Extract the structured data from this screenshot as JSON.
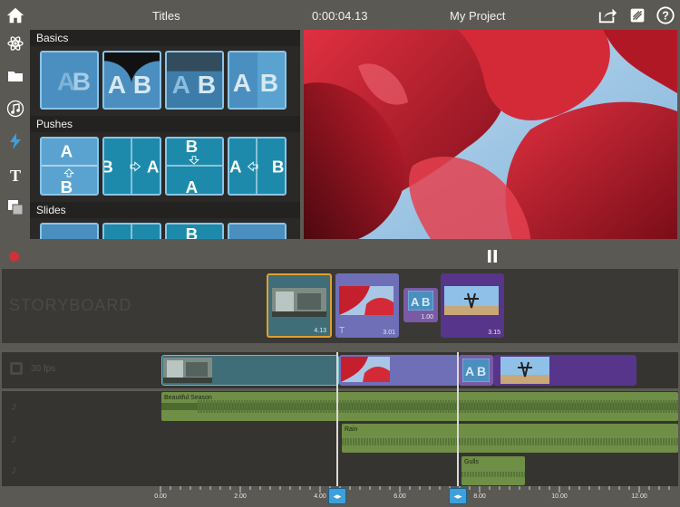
{
  "topbar": {
    "section_title": "Titles",
    "timecode": "0:00:04.13",
    "project_name": "My Project"
  },
  "library": {
    "sections": [
      "Basics",
      "Pushes",
      "Slides"
    ]
  },
  "storyboard": {
    "label": "STORYBOARD",
    "clips": [
      {
        "duration": "4.13"
      },
      {
        "duration": "3.01"
      },
      {
        "duration": "1.00"
      },
      {
        "duration": "3.15"
      }
    ]
  },
  "timeline": {
    "fps_label": "30 fps"
  },
  "audio": {
    "tracks": [
      {
        "label": "Beautiful Season"
      },
      {
        "label": "Rain"
      },
      {
        "label": "Gulls"
      }
    ]
  },
  "ruler": {
    "ticks": [
      "0.00",
      "2.00",
      "4.00",
      "6.00",
      "8.00",
      "10.00",
      "12.00"
    ]
  },
  "colors": {
    "accent": "#3ca0dc",
    "record": "#d0303a",
    "audio": "#6f8e46",
    "clip_selected": "#e0a030"
  }
}
